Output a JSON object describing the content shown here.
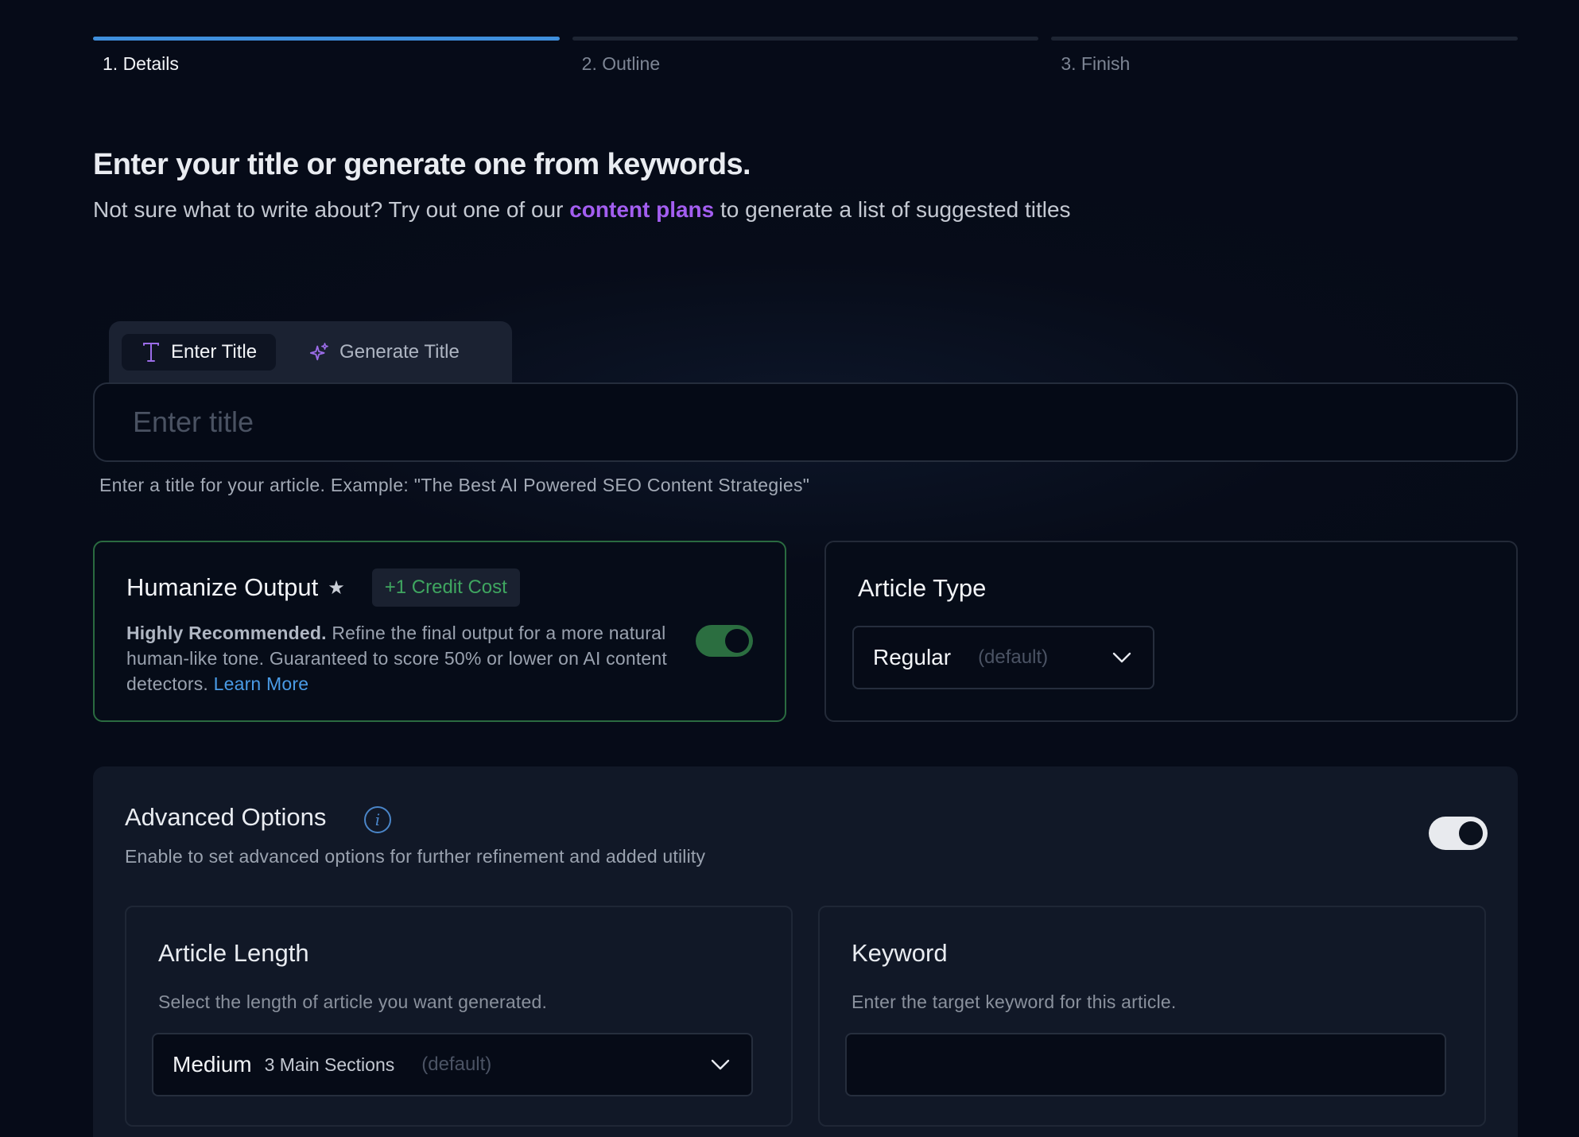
{
  "stepper": {
    "steps": [
      {
        "label": "1. Details",
        "active": true
      },
      {
        "label": "2. Outline",
        "active": false
      },
      {
        "label": "3. Finish",
        "active": false
      }
    ]
  },
  "header": {
    "title": "Enter your title or generate one from keywords.",
    "subtitle_prefix": "Not sure what to write about? Try out one of our",
    "subtitle_link": "content plans",
    "subtitle_suffix": "to generate a list of suggested titles"
  },
  "title_tabs": {
    "enter": {
      "label": "Enter Title",
      "icon": "letter-t-icon"
    },
    "generate": {
      "label": "Generate Title",
      "icon": "sparkles-icon"
    }
  },
  "title_input": {
    "placeholder": "Enter title",
    "value": "",
    "hint": "Enter a title for your article. Example: \"The Best AI Powered SEO Content Strategies\""
  },
  "humanize": {
    "title": "Humanize Output",
    "star": "★",
    "badge": "+1 Credit Cost",
    "desc_bold": "Highly Recommended.",
    "desc_text": "Refine the final output for a more natural human-like tone. Guaranteed to score 50% or lower on AI content detectors.",
    "learn_more": "Learn More",
    "enabled": true,
    "accent": "#2b6e40"
  },
  "article_type": {
    "title": "Article Type",
    "selected": "Regular",
    "default_note": "(default)"
  },
  "advanced": {
    "title": "Advanced Options",
    "info_glyph": "i",
    "subtitle": "Enable to set advanced options for further refinement and added utility",
    "enabled": true,
    "length": {
      "title": "Article Length",
      "desc": "Select the length of article you want generated.",
      "selected": "Medium",
      "sections": "3 Main Sections",
      "default_note": "(default)"
    },
    "keyword": {
      "title": "Keyword",
      "desc": "Enter the target keyword for this article.",
      "value": ""
    }
  },
  "colors": {
    "background": "#060b18",
    "active_step": "#3f8fdc",
    "link_purple": "#a35ef0",
    "link_blue": "#4a9be6",
    "badge_green": "#3fa660"
  }
}
